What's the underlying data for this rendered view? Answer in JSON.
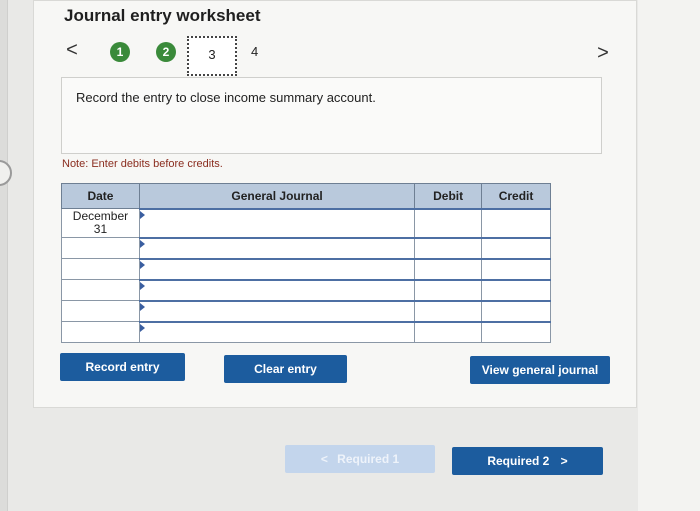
{
  "worksheet": {
    "title": "Journal entry worksheet",
    "nav_prev": "<",
    "nav_next": ">",
    "steps": [
      {
        "label": "1",
        "state": "done"
      },
      {
        "label": "2",
        "state": "done"
      },
      {
        "label": "3",
        "state": "current"
      },
      {
        "label": "4",
        "state": "pending"
      }
    ],
    "instruction": "Record the entry to close income summary account.",
    "note": "Note: Enter debits before credits."
  },
  "journal_table": {
    "headers": [
      "Date",
      "General Journal",
      "Debit",
      "Credit"
    ],
    "rows": [
      {
        "date_line1": "December",
        "date_line2": "31",
        "account": "",
        "debit": "",
        "credit": ""
      },
      {
        "date_line1": "",
        "date_line2": "",
        "account": "",
        "debit": "",
        "credit": ""
      },
      {
        "date_line1": "",
        "date_line2": "",
        "account": "",
        "debit": "",
        "credit": ""
      },
      {
        "date_line1": "",
        "date_line2": "",
        "account": "",
        "debit": "",
        "credit": ""
      },
      {
        "date_line1": "",
        "date_line2": "",
        "account": "",
        "debit": "",
        "credit": ""
      },
      {
        "date_line1": "",
        "date_line2": "",
        "account": "",
        "debit": "",
        "credit": ""
      }
    ]
  },
  "buttons": {
    "record_entry": "Record entry",
    "clear_entry": "Clear entry",
    "view_general_journal": "View general journal"
  },
  "pager": {
    "prev_arrow": "<",
    "prev_label": "Required 1",
    "next_label": "Required 2",
    "next_arrow": ">"
  },
  "colors": {
    "step_done": "#3a8a3a",
    "primary_button": "#1c5c9e",
    "disabled_button": "#c3d5ec",
    "table_header": "#b9c9dc",
    "note_text": "#8a2d1f"
  }
}
